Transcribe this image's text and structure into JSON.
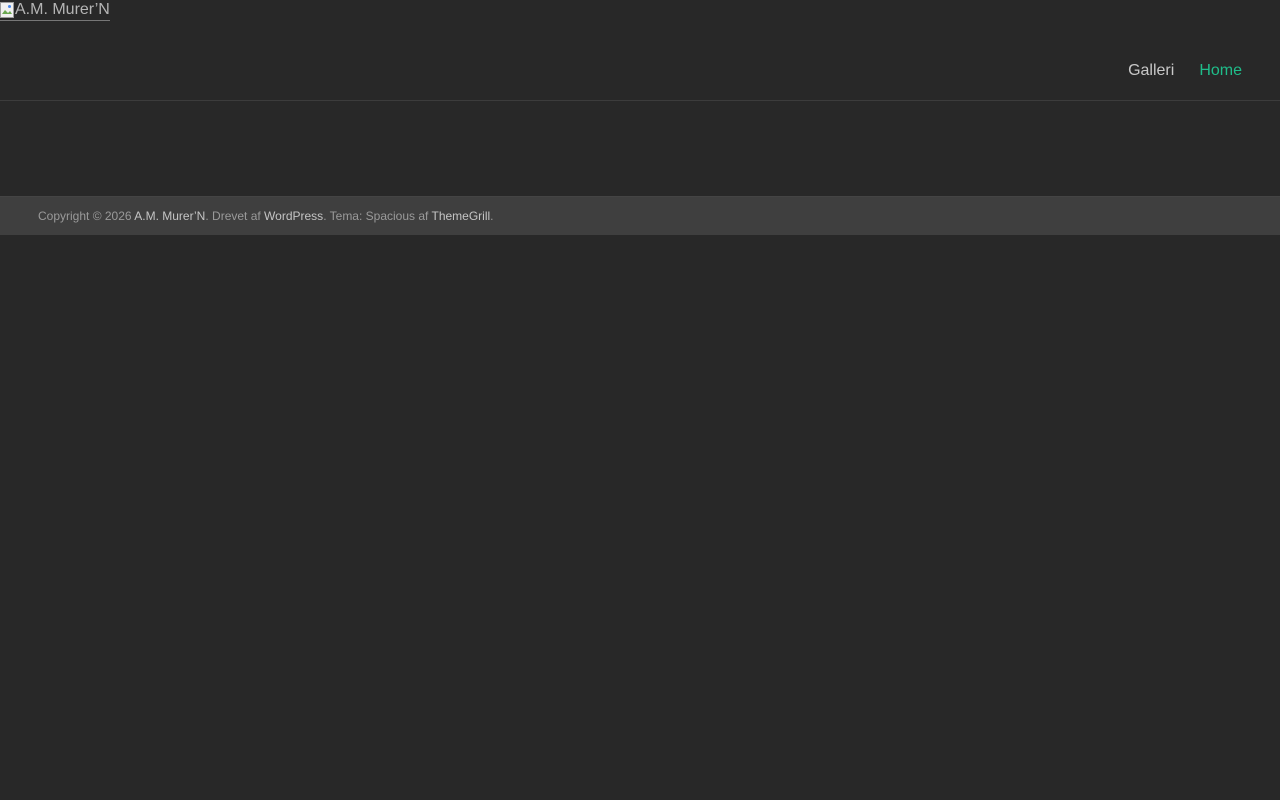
{
  "site": {
    "logo_alt": "A.M. Murer’N"
  },
  "nav": {
    "items": [
      {
        "label": "Galleri",
        "active": false
      },
      {
        "label": "Home",
        "active": true
      }
    ],
    "active_color": "#1fbd8a"
  },
  "footer": {
    "copyright_prefix": "Copyright © 2026 ",
    "site_link": "A.M. Murer’N",
    "powered_text": ". Drevet af ",
    "wordpress_link": "WordPress",
    "theme_text": ". Tema: Spacious af ",
    "themegrill_link": "ThemeGrill",
    "end_text": "."
  },
  "colors": {
    "background": "#282828",
    "footer_background": "#3f3f3f",
    "accent": "#1fbd8a"
  }
}
